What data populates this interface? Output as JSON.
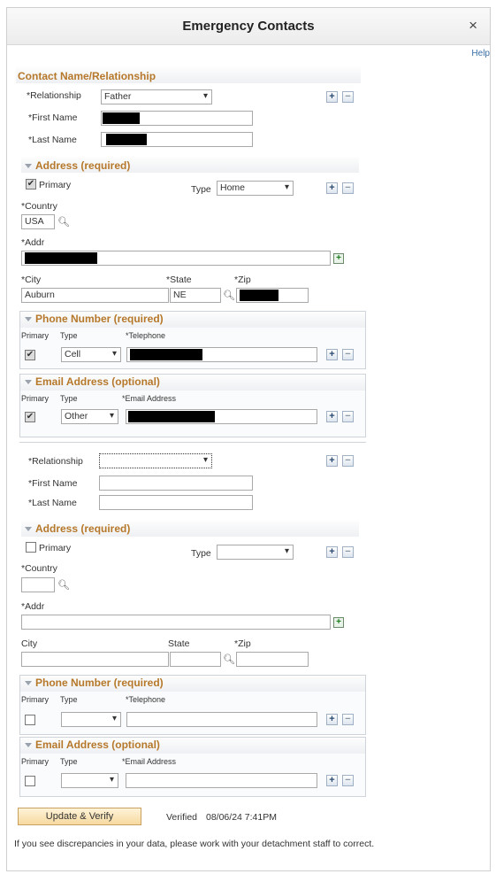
{
  "dialog": {
    "title": "Emergency Contacts",
    "close_glyph": "×",
    "help": "Help"
  },
  "contact1": {
    "section_title": "Contact Name/Relationship",
    "relationship_label": "*Relationship",
    "relationship_value": "Father",
    "first_name_label": "*First Name",
    "last_name_label": "*Last Name",
    "address": {
      "section_title": "Address (required)",
      "primary_label": "Primary",
      "primary_checked": true,
      "type_label": "Type",
      "type_value": "Home",
      "country_label": "*Country",
      "country_value": "USA",
      "addr_label": "*Addr",
      "city_label": "*City",
      "city_value": "Auburn",
      "state_label": "*State",
      "state_value": "NE",
      "zip_label": "*Zip"
    },
    "phone": {
      "section_title": "Phone Number (required)",
      "col_primary": "Primary",
      "col_type": "Type",
      "col_telephone": "*Telephone",
      "type_value": "Cell"
    },
    "email": {
      "section_title": "Email Address (optional)",
      "col_primary": "Primary",
      "col_type": "Type",
      "col_email": "*Email Address",
      "type_value": "Other"
    }
  },
  "contact2": {
    "relationship_label": "*Relationship",
    "first_name_label": "*First Name",
    "last_name_label": "*Last Name",
    "address": {
      "section_title": "Address (required)",
      "primary_label": "Primary",
      "type_label": "Type",
      "country_label": "*Country",
      "addr_label": "*Addr",
      "city_label": "City",
      "state_label": "State",
      "zip_label": "*Zip"
    },
    "phone": {
      "section_title": "Phone Number (required)",
      "col_primary": "Primary",
      "col_type": "Type",
      "col_telephone": "*Telephone"
    },
    "email": {
      "section_title": "Email Address (optional)",
      "col_primary": "Primary",
      "col_type": "Type",
      "col_email": "*Email Address"
    }
  },
  "footer": {
    "update_button": "Update & Verify",
    "verified_label": "Verified",
    "verified_value": "08/06/24  7:41PM",
    "note": "If you see discrepancies in your data, please work with your detachment staff to correct."
  },
  "icons": {
    "add": "+",
    "remove": "−",
    "lookup": "magnifier-icon",
    "checkmark": "✔",
    "dropdown": "▾"
  }
}
